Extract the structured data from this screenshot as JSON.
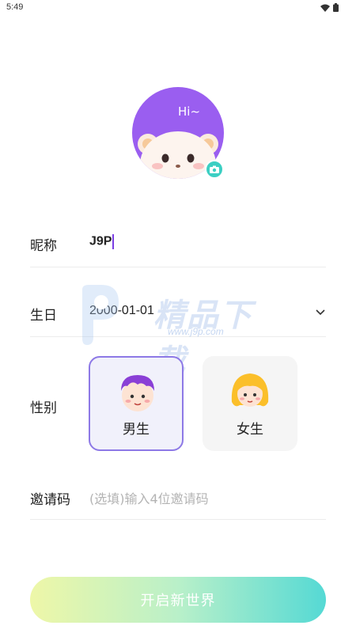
{
  "status_bar": {
    "time": "5:49",
    "icons": [
      "wifi-icon",
      "battery-icon"
    ]
  },
  "profile": {
    "avatar_text": "Hi~",
    "camera_icon": "camera-icon"
  },
  "form": {
    "nickname": {
      "label": "昵称",
      "value": "J9P"
    },
    "birthday": {
      "label": "生日",
      "value": "2000-01-01",
      "icon": "chevron-down-icon"
    },
    "gender": {
      "label": "性别",
      "options": [
        {
          "label": "男生",
          "selected": true
        },
        {
          "label": "女生",
          "selected": false
        }
      ]
    },
    "invite": {
      "label": "邀请码",
      "placeholder": "(选填)输入4位邀请码"
    }
  },
  "watermark": {
    "text": "精品下载",
    "url": "www.j9p.com"
  },
  "cta": {
    "label": "开启新世界"
  },
  "colors": {
    "accent": "#8d79e6",
    "teal": "#3ccfc3",
    "gradient_start": "#eef7a8",
    "gradient_end": "#55d9d4"
  }
}
